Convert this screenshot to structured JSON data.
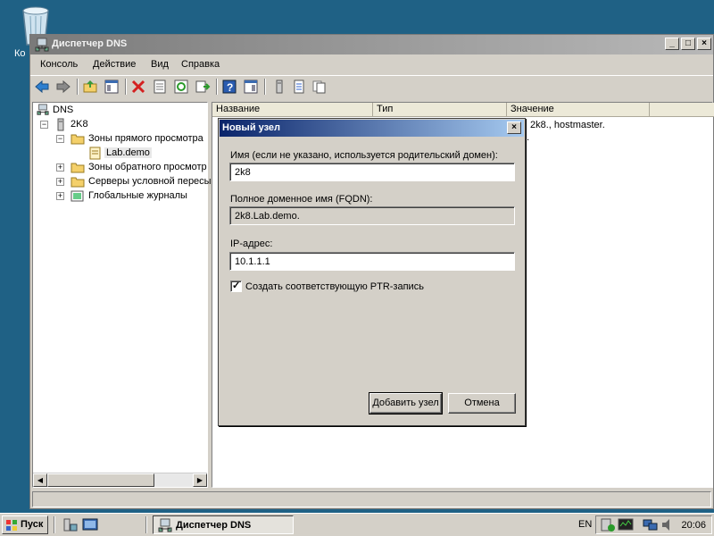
{
  "desktop": {
    "icon_label": "Ко"
  },
  "window": {
    "title": "Диспетчер DNS",
    "menu": [
      "Консоль",
      "Действие",
      "Вид",
      "Справка"
    ]
  },
  "tree": {
    "root": "DNS",
    "server": "2K8",
    "forward_zones": "Зоны прямого просмотра",
    "zone": "Lab.demo",
    "reverse_zones": "Зоны обратного просмотр",
    "conditional_forwarders": "Серверы условной пересы",
    "global_logs": "Глобальные журналы"
  },
  "list": {
    "columns": [
      "Название",
      "Тип",
      "Значение"
    ],
    "value_1": "2k8., hostmaster.",
    "value_2": "."
  },
  "dialog": {
    "title": "Новый узел",
    "name_label": "Имя (если не указано, используется родительский домен):",
    "name_value": "2k8",
    "fqdn_label": "Полное доменное имя (FQDN):",
    "fqdn_value": "2k8.Lab.demo.",
    "ip_label": "IP-адрес:",
    "ip_value": "10.1.1.1",
    "ptr_label": "Создать соответствующую PTR-запись",
    "ptr_checked": true,
    "add_button": "Добавить узел",
    "cancel_button": "Отмена"
  },
  "taskbar": {
    "start": "Пуск",
    "task": "Диспетчер DNS",
    "lang": "EN",
    "time": "20:06"
  }
}
